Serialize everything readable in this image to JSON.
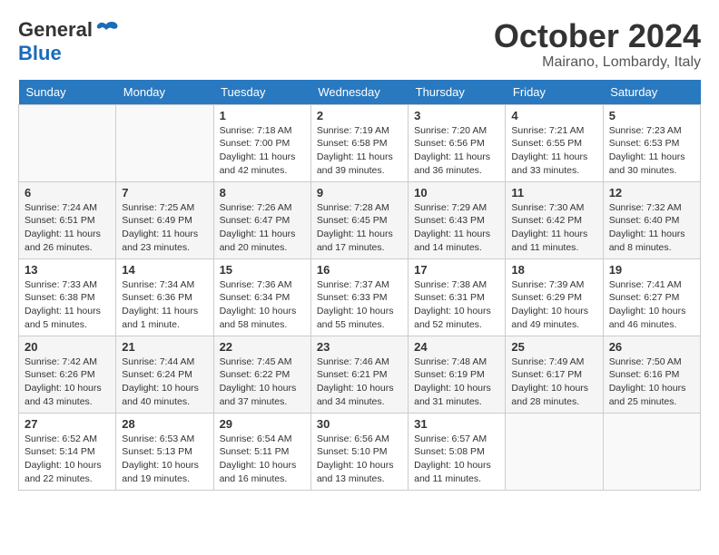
{
  "header": {
    "logo_general": "General",
    "logo_blue": "Blue",
    "month_title": "October 2024",
    "location": "Mairano, Lombardy, Italy"
  },
  "calendar": {
    "days_of_week": [
      "Sunday",
      "Monday",
      "Tuesday",
      "Wednesday",
      "Thursday",
      "Friday",
      "Saturday"
    ],
    "weeks": [
      [
        {
          "day": "",
          "sunrise": "",
          "sunset": "",
          "daylight": ""
        },
        {
          "day": "",
          "sunrise": "",
          "sunset": "",
          "daylight": ""
        },
        {
          "day": "1",
          "sunrise": "Sunrise: 7:18 AM",
          "sunset": "Sunset: 7:00 PM",
          "daylight": "Daylight: 11 hours and 42 minutes."
        },
        {
          "day": "2",
          "sunrise": "Sunrise: 7:19 AM",
          "sunset": "Sunset: 6:58 PM",
          "daylight": "Daylight: 11 hours and 39 minutes."
        },
        {
          "day": "3",
          "sunrise": "Sunrise: 7:20 AM",
          "sunset": "Sunset: 6:56 PM",
          "daylight": "Daylight: 11 hours and 36 minutes."
        },
        {
          "day": "4",
          "sunrise": "Sunrise: 7:21 AM",
          "sunset": "Sunset: 6:55 PM",
          "daylight": "Daylight: 11 hours and 33 minutes."
        },
        {
          "day": "5",
          "sunrise": "Sunrise: 7:23 AM",
          "sunset": "Sunset: 6:53 PM",
          "daylight": "Daylight: 11 hours and 30 minutes."
        }
      ],
      [
        {
          "day": "6",
          "sunrise": "Sunrise: 7:24 AM",
          "sunset": "Sunset: 6:51 PM",
          "daylight": "Daylight: 11 hours and 26 minutes."
        },
        {
          "day": "7",
          "sunrise": "Sunrise: 7:25 AM",
          "sunset": "Sunset: 6:49 PM",
          "daylight": "Daylight: 11 hours and 23 minutes."
        },
        {
          "day": "8",
          "sunrise": "Sunrise: 7:26 AM",
          "sunset": "Sunset: 6:47 PM",
          "daylight": "Daylight: 11 hours and 20 minutes."
        },
        {
          "day": "9",
          "sunrise": "Sunrise: 7:28 AM",
          "sunset": "Sunset: 6:45 PM",
          "daylight": "Daylight: 11 hours and 17 minutes."
        },
        {
          "day": "10",
          "sunrise": "Sunrise: 7:29 AM",
          "sunset": "Sunset: 6:43 PM",
          "daylight": "Daylight: 11 hours and 14 minutes."
        },
        {
          "day": "11",
          "sunrise": "Sunrise: 7:30 AM",
          "sunset": "Sunset: 6:42 PM",
          "daylight": "Daylight: 11 hours and 11 minutes."
        },
        {
          "day": "12",
          "sunrise": "Sunrise: 7:32 AM",
          "sunset": "Sunset: 6:40 PM",
          "daylight": "Daylight: 11 hours and 8 minutes."
        }
      ],
      [
        {
          "day": "13",
          "sunrise": "Sunrise: 7:33 AM",
          "sunset": "Sunset: 6:38 PM",
          "daylight": "Daylight: 11 hours and 5 minutes."
        },
        {
          "day": "14",
          "sunrise": "Sunrise: 7:34 AM",
          "sunset": "Sunset: 6:36 PM",
          "daylight": "Daylight: 11 hours and 1 minute."
        },
        {
          "day": "15",
          "sunrise": "Sunrise: 7:36 AM",
          "sunset": "Sunset: 6:34 PM",
          "daylight": "Daylight: 10 hours and 58 minutes."
        },
        {
          "day": "16",
          "sunrise": "Sunrise: 7:37 AM",
          "sunset": "Sunset: 6:33 PM",
          "daylight": "Daylight: 10 hours and 55 minutes."
        },
        {
          "day": "17",
          "sunrise": "Sunrise: 7:38 AM",
          "sunset": "Sunset: 6:31 PM",
          "daylight": "Daylight: 10 hours and 52 minutes."
        },
        {
          "day": "18",
          "sunrise": "Sunrise: 7:39 AM",
          "sunset": "Sunset: 6:29 PM",
          "daylight": "Daylight: 10 hours and 49 minutes."
        },
        {
          "day": "19",
          "sunrise": "Sunrise: 7:41 AM",
          "sunset": "Sunset: 6:27 PM",
          "daylight": "Daylight: 10 hours and 46 minutes."
        }
      ],
      [
        {
          "day": "20",
          "sunrise": "Sunrise: 7:42 AM",
          "sunset": "Sunset: 6:26 PM",
          "daylight": "Daylight: 10 hours and 43 minutes."
        },
        {
          "day": "21",
          "sunrise": "Sunrise: 7:44 AM",
          "sunset": "Sunset: 6:24 PM",
          "daylight": "Daylight: 10 hours and 40 minutes."
        },
        {
          "day": "22",
          "sunrise": "Sunrise: 7:45 AM",
          "sunset": "Sunset: 6:22 PM",
          "daylight": "Daylight: 10 hours and 37 minutes."
        },
        {
          "day": "23",
          "sunrise": "Sunrise: 7:46 AM",
          "sunset": "Sunset: 6:21 PM",
          "daylight": "Daylight: 10 hours and 34 minutes."
        },
        {
          "day": "24",
          "sunrise": "Sunrise: 7:48 AM",
          "sunset": "Sunset: 6:19 PM",
          "daylight": "Daylight: 10 hours and 31 minutes."
        },
        {
          "day": "25",
          "sunrise": "Sunrise: 7:49 AM",
          "sunset": "Sunset: 6:17 PM",
          "daylight": "Daylight: 10 hours and 28 minutes."
        },
        {
          "day": "26",
          "sunrise": "Sunrise: 7:50 AM",
          "sunset": "Sunset: 6:16 PM",
          "daylight": "Daylight: 10 hours and 25 minutes."
        }
      ],
      [
        {
          "day": "27",
          "sunrise": "Sunrise: 6:52 AM",
          "sunset": "Sunset: 5:14 PM",
          "daylight": "Daylight: 10 hours and 22 minutes."
        },
        {
          "day": "28",
          "sunrise": "Sunrise: 6:53 AM",
          "sunset": "Sunset: 5:13 PM",
          "daylight": "Daylight: 10 hours and 19 minutes."
        },
        {
          "day": "29",
          "sunrise": "Sunrise: 6:54 AM",
          "sunset": "Sunset: 5:11 PM",
          "daylight": "Daylight: 10 hours and 16 minutes."
        },
        {
          "day": "30",
          "sunrise": "Sunrise: 6:56 AM",
          "sunset": "Sunset: 5:10 PM",
          "daylight": "Daylight: 10 hours and 13 minutes."
        },
        {
          "day": "31",
          "sunrise": "Sunrise: 6:57 AM",
          "sunset": "Sunset: 5:08 PM",
          "daylight": "Daylight: 10 hours and 11 minutes."
        },
        {
          "day": "",
          "sunrise": "",
          "sunset": "",
          "daylight": ""
        },
        {
          "day": "",
          "sunrise": "",
          "sunset": "",
          "daylight": ""
        }
      ]
    ]
  }
}
